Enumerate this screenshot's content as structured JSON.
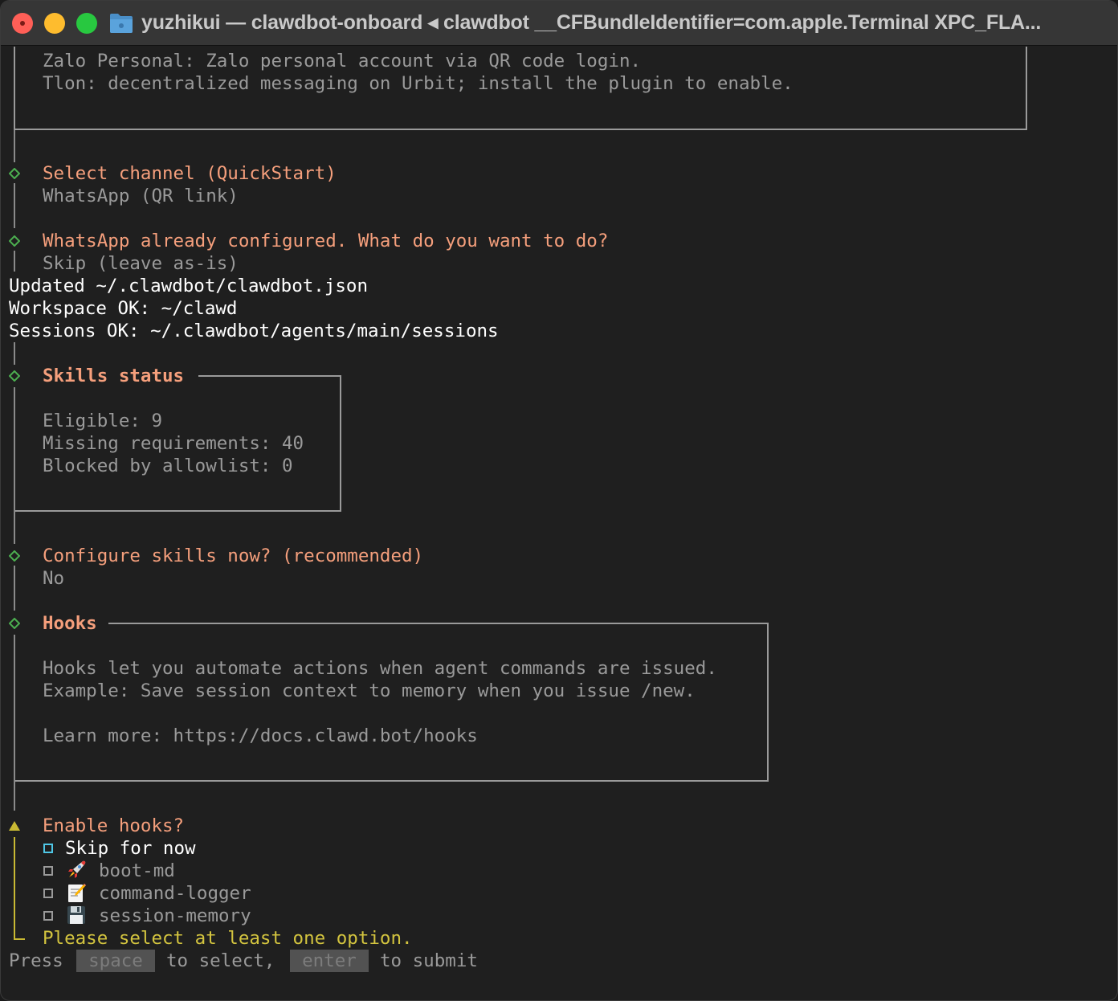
{
  "window": {
    "title": "yuzhikui — clawdbot-onboard ◂ clawdbot __CFBundleIdentifier=com.apple.Terminal XPC_FLA..."
  },
  "channels_box": {
    "lines": [
      "Zalo Personal: Zalo personal account via QR code login.",
      "Tlon: decentralized messaging on Urbit; install the plugin to enable."
    ]
  },
  "select_channel": {
    "label": "Select channel (QuickStart)",
    "value": "WhatsApp (QR link)"
  },
  "whatsapp_configured": {
    "label": "WhatsApp already configured. What do you want to do?",
    "value": "Skip (leave as-is)"
  },
  "log_lines": [
    "Updated ~/.clawdbot/clawdbot.json",
    "Workspace OK: ~/clawd",
    "Sessions OK: ~/.clawdbot/agents/main/sessions"
  ],
  "skills_status": {
    "title": "Skills status",
    "lines": [
      "Eligible: 9",
      "Missing requirements: 40",
      "Blocked by allowlist: 0"
    ]
  },
  "configure_skills": {
    "label": "Configure skills now? (recommended)",
    "value": "No"
  },
  "hooks": {
    "title": "Hooks",
    "lines": [
      "Hooks let you automate actions when agent commands are issued.",
      "Example: Save session context to memory when you issue /new.",
      "",
      "Learn more: https://docs.clawd.bot/hooks"
    ]
  },
  "enable_hooks": {
    "label": "Enable hooks?",
    "options": [
      {
        "label": "Skip for now",
        "icon": "",
        "active": true
      },
      {
        "label": "boot-md",
        "icon": "rocket-icon",
        "active": false
      },
      {
        "label": "command-logger",
        "icon": "memo-icon",
        "active": false
      },
      {
        "label": "session-memory",
        "icon": "floppy-disk-icon",
        "active": false
      }
    ],
    "error": "Please select at least one option."
  },
  "footer": {
    "press": "Press",
    "space_key": "space",
    "to_select": "to select,",
    "enter_key": "enter",
    "to_submit": "to submit"
  },
  "colors": {
    "accent_orange": "#f59f7c",
    "prompt_green": "#4caf50",
    "warn_yellow": "#d3c43f",
    "cursor_cyan": "#4fc7e6"
  }
}
